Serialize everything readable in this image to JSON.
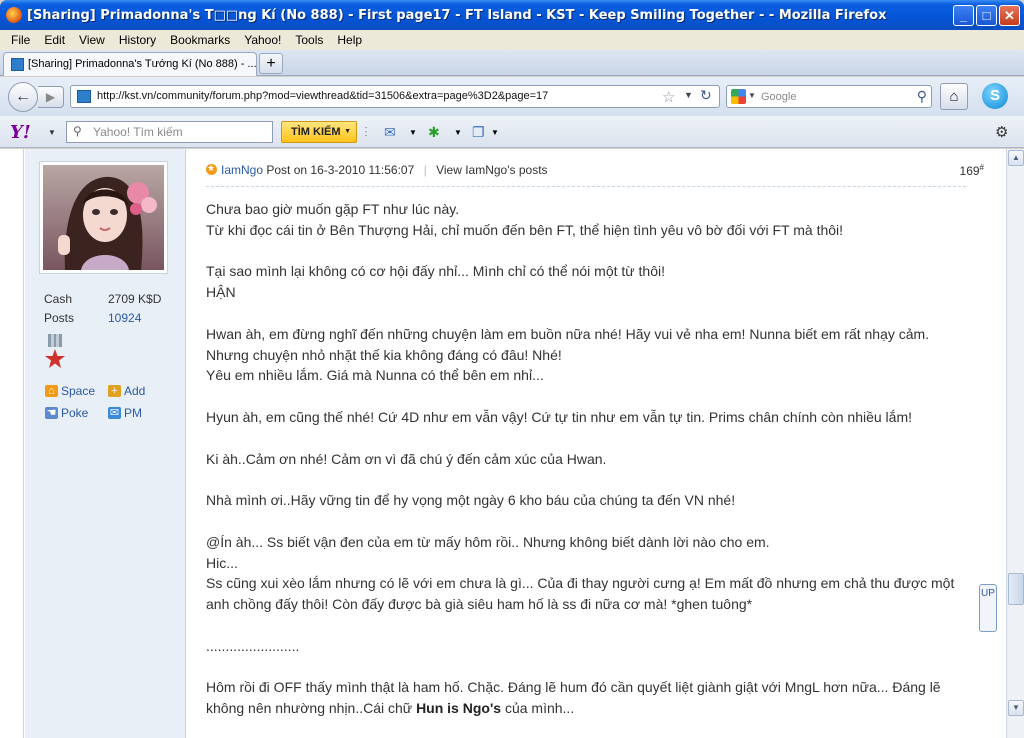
{
  "window": {
    "title": "[Sharing] Primadonna's T□□ng Kí (No 888) - First page17 - FT Island - KST - Keep Smiling Together - - Mozilla Firefox",
    "controls": [
      "_",
      "□",
      "✕"
    ]
  },
  "menu": [
    "File",
    "Edit",
    "View",
    "History",
    "Bookmarks",
    "Yahoo!",
    "Tools",
    "Help"
  ],
  "tab": {
    "label": "[Sharing] Primadonna's Tướng Kí (No 888) - ...",
    "new_tab": "+"
  },
  "nav": {
    "back": "←",
    "forward": "▶",
    "url": "http://kst.vn/community/forum.php?mod=viewthread&tid=31506&extra=page%3D2&page=17",
    "star": "☆",
    "reload": "↻",
    "search_placeholder": "Google",
    "home": "⌂",
    "skype": "S"
  },
  "yahoo_toolbar": {
    "logo": "Y!",
    "search_placeholder": "Yahoo! Tìm kiếm",
    "button": "TÌM KIẾM"
  },
  "profile": {
    "stats": [
      {
        "label": "Cash",
        "value": "2709 K$D"
      },
      {
        "label": "Posts",
        "value": "10924"
      }
    ],
    "links": [
      {
        "label": "Space",
        "icon": "home-icon",
        "color": "#f29a16"
      },
      {
        "label": "Add",
        "icon": "handshake-icon",
        "color": "#e0a020"
      },
      {
        "label": "Poke",
        "icon": "poke-icon",
        "color": "#5a8ad0"
      },
      {
        "label": "PM",
        "icon": "mail-icon",
        "color": "#3a8ad8"
      }
    ]
  },
  "post": {
    "author": "IamNgo",
    "posted": "Post on 16-3-2010 11:56:07",
    "view_posts": "View IamNgo's posts",
    "number": "169",
    "number_sup": "#",
    "paragraphs": [
      [
        "Chưa bao giờ muốn gặp FT như lúc này.",
        "Từ khi đọc cái tin ở Bên Thượng Hải, chỉ muốn đến bên FT, thể hiện tình yêu vô bờ đối với FT mà thôi!"
      ],
      [
        "Tại sao mình lại không có cơ hội đấy nhỉ... Mình chỉ có thể nói một từ thôi!",
        "HẬN"
      ],
      [
        "Hwan àh, em đừng nghĩ đến những chuyện làm em buồn nữa nhé! Hãy vui vẻ nha em! Nunna biết em rất nhạy cảm.",
        "Nhưng chuyện nhỏ nhặt thế kia không đáng có đâu! Nhé!",
        "Yêu em nhiều lắm. Giá mà Nunna có thể bên em nhỉ..."
      ],
      [
        "Hyun àh, em cũng thế nhé! Cứ 4D như em vẫn vậy! Cứ tự tin như em vẫn tự tin. Prims chân chính còn nhiều lắm!"
      ],
      [
        "Ki àh..Cảm ơn nhé! Cảm ơn vì đã chú ý đến cảm xúc của Hwan."
      ],
      [
        "Nhà mình ơi..Hãy vững tin để hy vọng một ngày 6 kho báu của chúng ta đến VN nhé!"
      ],
      [
        "@Ín àh... Ss biết vận đen của em từ mấy hôm rồi.. Nhưng không biết dành lời nào cho em.",
        "Hic...",
        "Ss cũng xui xèo lắm nhưng có lẽ với em chưa là gì... Của đi thay người cưng ạ! Em mất đồ nhưng em chả thu được một",
        "anh chồng đấy thôi! Còn đấy được bà già siêu ham hố là ss đi nữa cơ mà! *ghen tuông*"
      ],
      [
        "........................"
      ]
    ],
    "last_line1": "Hôm rồi đi OFF thấy mình thật là ham hố. Chặc. Đáng lẽ hum đó cần quyết liệt giành giật với MngL hơn nữa... Đáng lẽ",
    "last_line2_pre": "không nên nhường nhịn..Cái chữ ",
    "last_line2_bold": "Hun is Ngo's",
    "last_line2_post": " của mình..."
  },
  "side_widget": "UP",
  "colors": {
    "titlebar": "#0554d6",
    "link": "#2a5aa5",
    "profile_bg": "#e8eff7"
  }
}
